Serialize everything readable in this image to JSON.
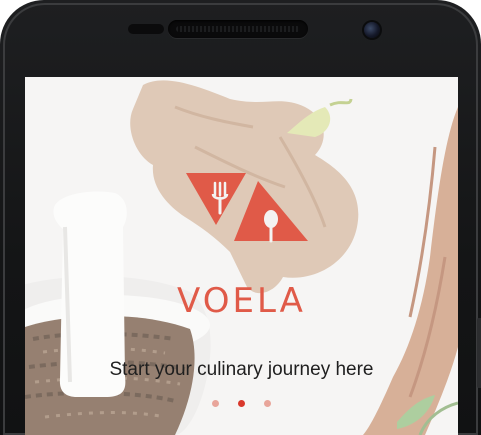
{
  "onboarding": {
    "brand_name": "VOELA",
    "tagline": "Start your culinary journey here",
    "slides": 3,
    "active_slide": 2
  },
  "logo": {
    "icon": "fork-and-spoon-triangle-icon",
    "color": "#e05a48"
  },
  "background": {
    "description_icon": "ginger-and-mortar-photo"
  },
  "colors": {
    "accent": "#e05a48",
    "dot_active": "#d9382b",
    "dot_inactive": "#e8a59a",
    "device_frame": "#1a1b1d"
  }
}
